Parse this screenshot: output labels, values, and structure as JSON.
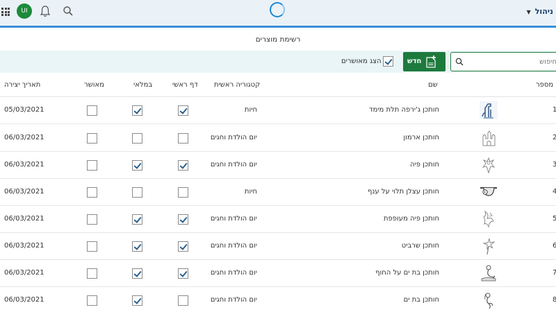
{
  "topbar": {
    "user_initials": "UI",
    "app_name": "ניהול"
  },
  "page": {
    "title": "רשימת מוצרים"
  },
  "toolbar": {
    "search_placeholder": "חיפוש",
    "new_button_label": "חדש",
    "show_approved_label": "הצג מאושרים",
    "show_approved_checked": true
  },
  "table": {
    "headers": {
      "number": "מספר",
      "name": "שם",
      "category": "קטגוריה ראשית",
      "home_page": "דף ראשי",
      "in_stock": "במלאי",
      "approved": "מאושר",
      "created": "תאריך יצירה"
    },
    "rows": [
      {
        "num": "1",
        "name": "חותכן ג'ירפה תלת מימד",
        "category": "חיות",
        "home_page": true,
        "in_stock": true,
        "approved": false,
        "created": "05/03/2021"
      },
      {
        "num": "2",
        "name": "חותכן ארמון",
        "category": "יום הולדת וחגים",
        "home_page": false,
        "in_stock": false,
        "approved": false,
        "created": "06/03/2021"
      },
      {
        "num": "3",
        "name": "חותכן פיה",
        "category": "יום הולדת וחגים",
        "home_page": true,
        "in_stock": true,
        "approved": false,
        "created": "06/03/2021"
      },
      {
        "num": "4",
        "name": "חותכן עצלן תלוי על ענף",
        "category": "חיות",
        "home_page": false,
        "in_stock": false,
        "approved": false,
        "created": "06/03/2021"
      },
      {
        "num": "5",
        "name": "חותכן פיה מעופפת",
        "category": "יום הולדת וחגים",
        "home_page": true,
        "in_stock": true,
        "approved": false,
        "created": "06/03/2021"
      },
      {
        "num": "6",
        "name": "חותכן שרביט",
        "category": "יום הולדת וחגים",
        "home_page": true,
        "in_stock": true,
        "approved": false,
        "created": "06/03/2021"
      },
      {
        "num": "7",
        "name": "חותכן בת ים על החוף",
        "category": "יום הולדת וחגים",
        "home_page": true,
        "in_stock": true,
        "approved": false,
        "created": "06/03/2021"
      },
      {
        "num": "8",
        "name": "חותכן בת ים",
        "category": "יום הולדת וחגים",
        "home_page": false,
        "in_stock": true,
        "approved": false,
        "created": "06/03/2021"
      }
    ]
  }
}
